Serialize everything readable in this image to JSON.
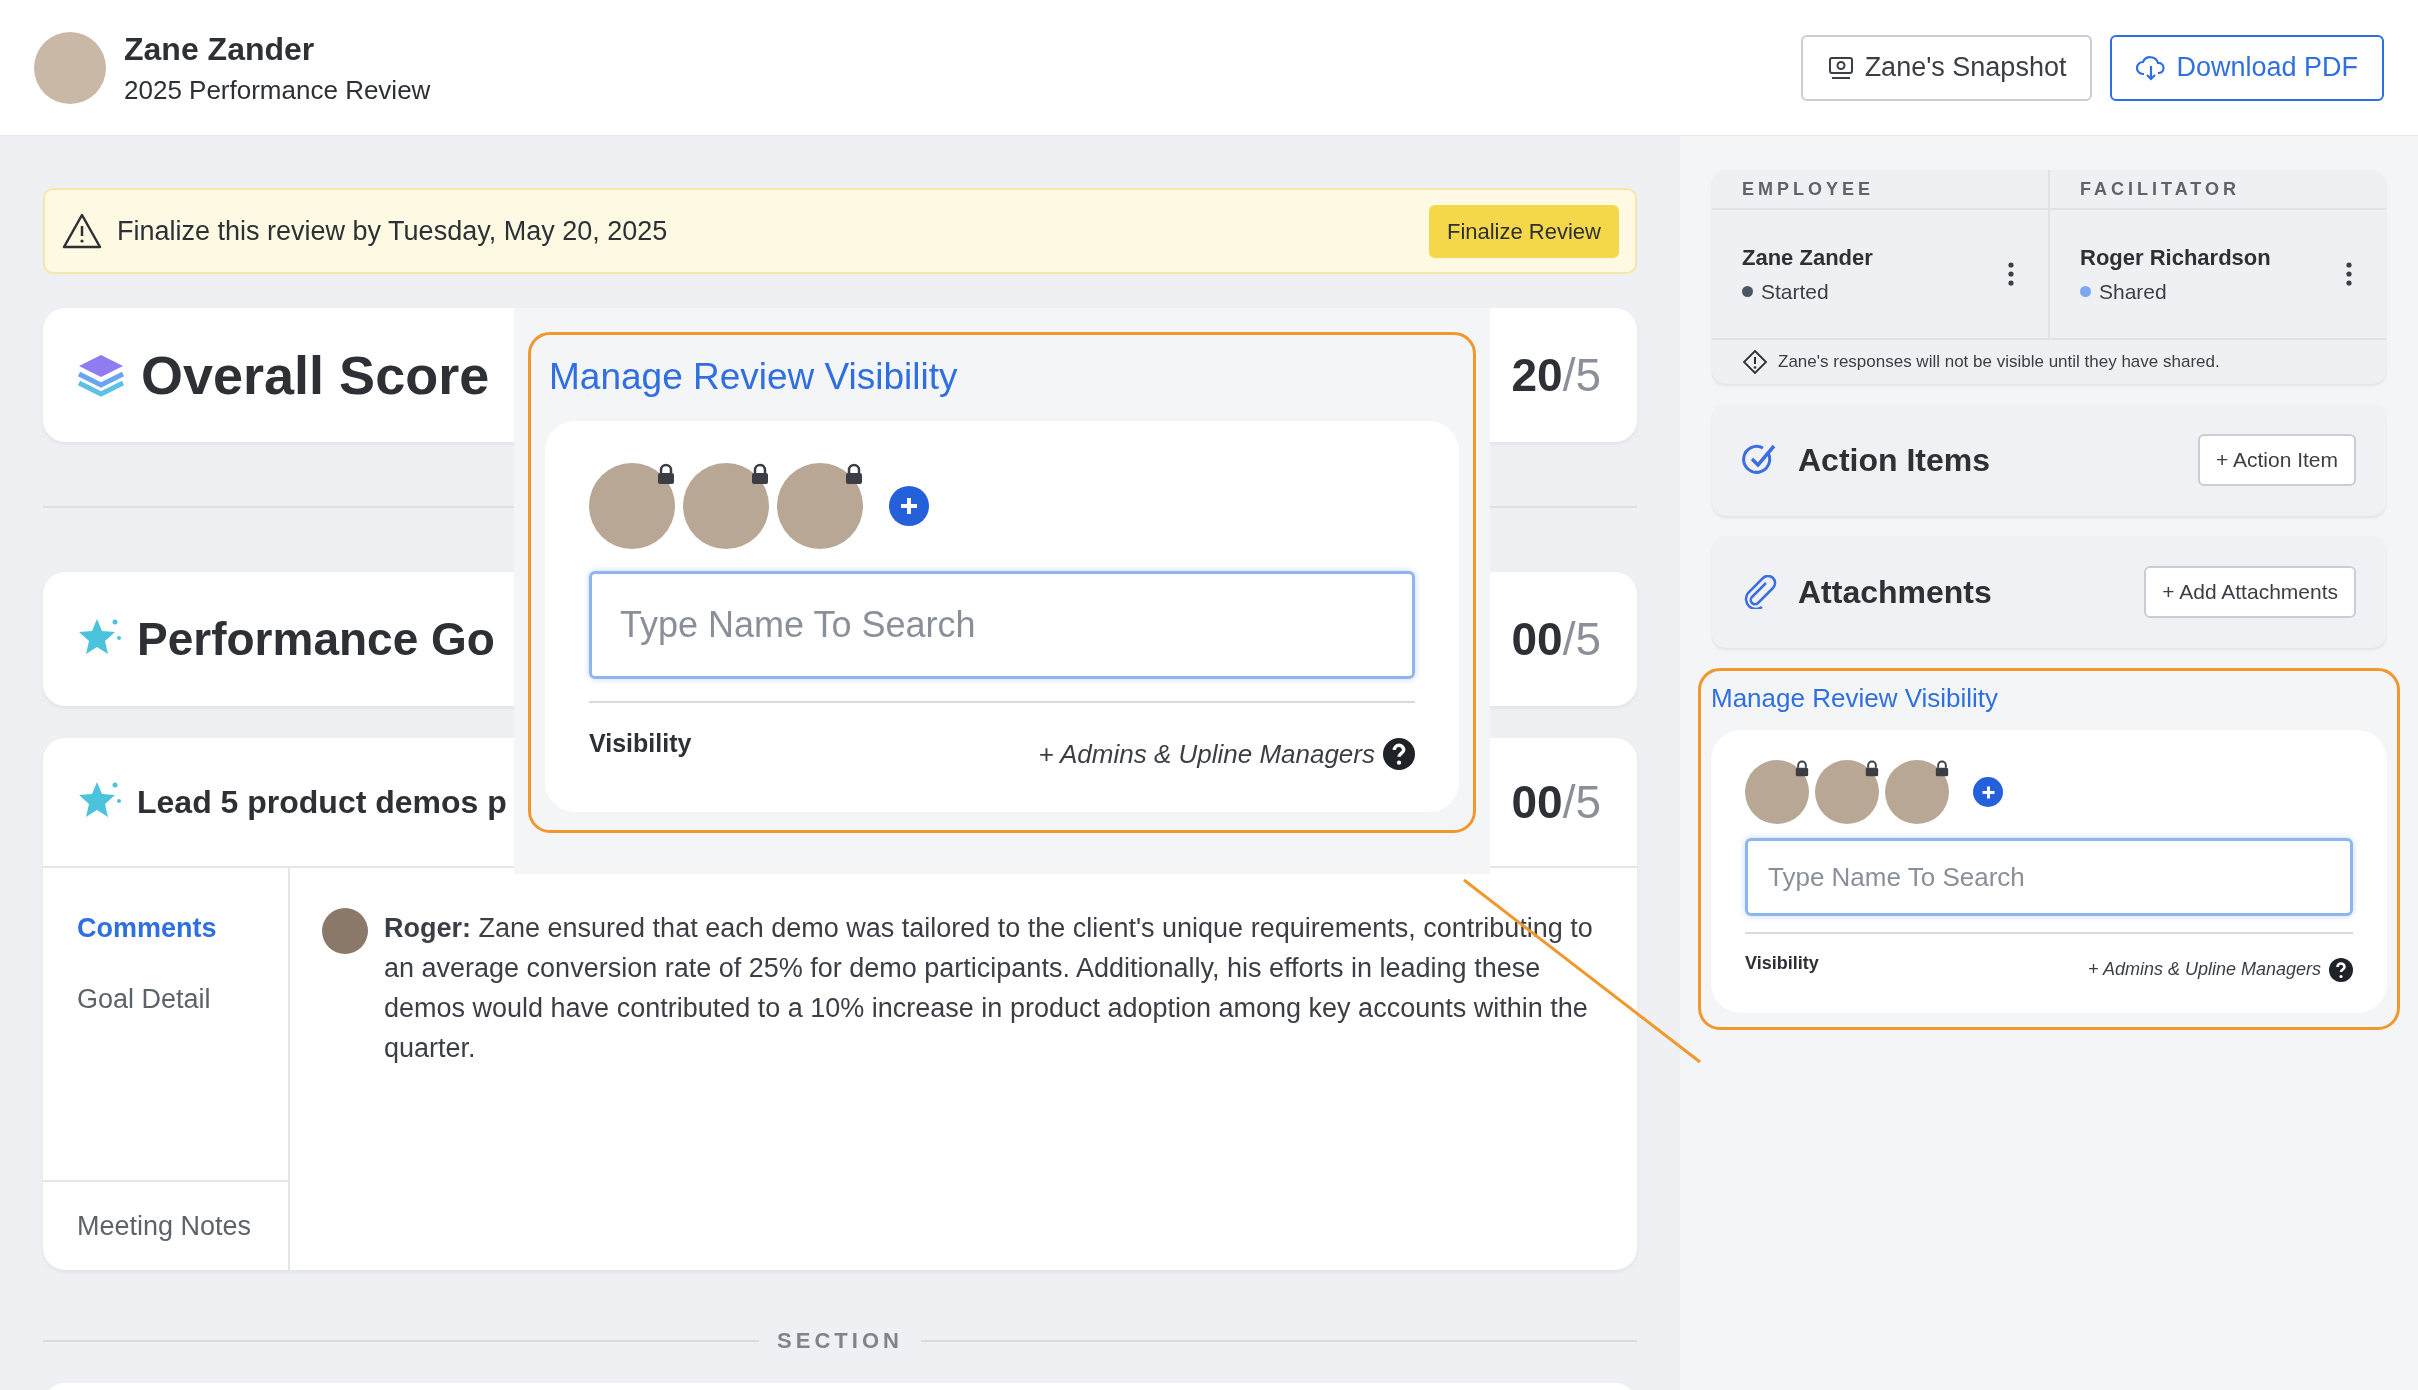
{
  "header": {
    "name": "Zane Zander",
    "subtitle": "2025 Performance Review"
  },
  "header_buttons": [
    {
      "label": "Zane's Snapshot",
      "kind": "secondary"
    },
    {
      "label": "Download PDF",
      "kind": "primary"
    }
  ],
  "banner": {
    "message": "Finalize this review by Tuesday, May 20, 2025",
    "button": "Finalize Review"
  },
  "score_cards": [
    {
      "kind": "overall",
      "title": "Overall Score",
      "score": "20",
      "out_of": "/5"
    },
    {
      "kind": "goals",
      "title": "Performance Go",
      "score": "00",
      "out_of": "/5"
    }
  ],
  "goal_card": {
    "title": "Lead 5 product demos p",
    "score": "00",
    "out_of": "/5",
    "tabs": [
      {
        "label": "Comments",
        "selected": true
      },
      {
        "label": "Goal Detail",
        "selected": false
      }
    ],
    "footer_tab": "Meeting Notes",
    "comment": "**Roger:** Zane ensured that each demo was tailored to the client's unique requirements, contributing to an average conversion rate of 25% for demo participants. Additionally, his efforts in leading these demos would have contributed to a 10% increase in product adoption among key accounts within the quarter."
  },
  "section_label": "SECTION",
  "participants": [
    {
      "role": "EMPLOYEE",
      "name": "Zane Zander",
      "status": "Started",
      "color": "#4b5563"
    },
    {
      "role": "FACILITATOR",
      "name": "Roger Richardson",
      "status": "Shared",
      "color": "#7ba7f0"
    }
  ],
  "notice": "Zane's responses will not be visible until they have shared.",
  "side_cards": [
    {
      "kind": "action",
      "title": "Action Items",
      "button": "+ Action Item"
    },
    {
      "kind": "attach",
      "title": "Attachments",
      "button": "+ Add Attachments"
    }
  ],
  "visibility_panels": [
    {
      "title": "Manage Review Visibility",
      "people": [
        {
          "locked": true
        },
        {
          "locked": true
        },
        {
          "locked": true
        }
      ],
      "placeholder": "Type Name To Search",
      "label": "Visibility",
      "scope": "+ Admins & Upline Managers"
    },
    {
      "title": "Manage Review Visibility",
      "people": [
        {
          "locked": true
        },
        {
          "locked": true
        },
        {
          "locked": true
        }
      ],
      "placeholder": "Type Name To Search",
      "label": "Visibility",
      "scope": "+ Admins & Upline Managers"
    }
  ]
}
